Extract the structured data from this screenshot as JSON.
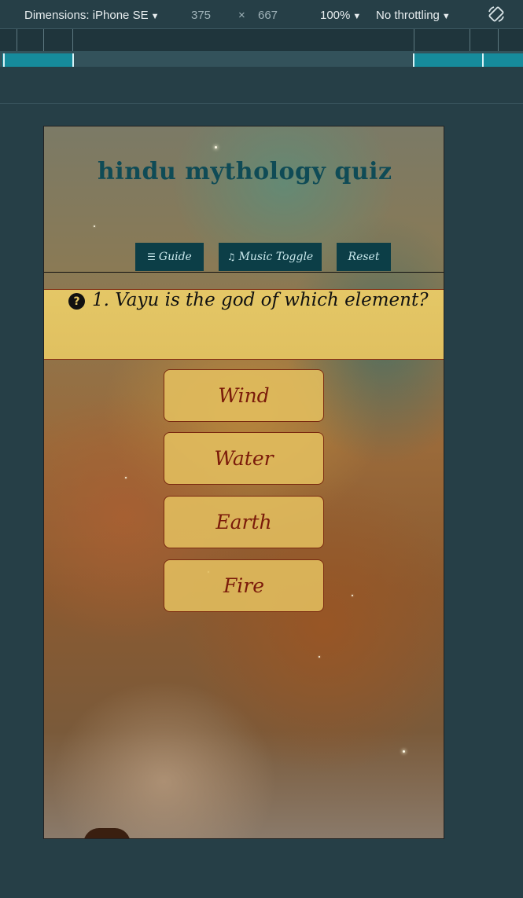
{
  "devtools": {
    "device_label": "Dimensions: iPhone SE",
    "width": "375",
    "times": "×",
    "height": "667",
    "zoom": "100%",
    "throttle": "No throttling",
    "caret": "▼",
    "rotate_icon": "rotate-icon"
  },
  "site": {
    "title": "hindu mythology quiz",
    "nav": [
      {
        "label": "Guide",
        "icon": "☰"
      },
      {
        "label": "Music Toggle",
        "icon": "♫"
      },
      {
        "label": "Reset",
        "icon": ""
      }
    ]
  },
  "quiz": {
    "question_icon": "?",
    "question": "1. Vayu is the god of which element?",
    "answers": [
      "Wind",
      "Water",
      "Earth",
      "Fire"
    ]
  },
  "colors": {
    "devtools_bg": "#263f47",
    "title": "#0f4b56",
    "nav_bg": "#0c3e47",
    "question_bg": "#e4c766",
    "answer_text": "#7a1a0a"
  }
}
